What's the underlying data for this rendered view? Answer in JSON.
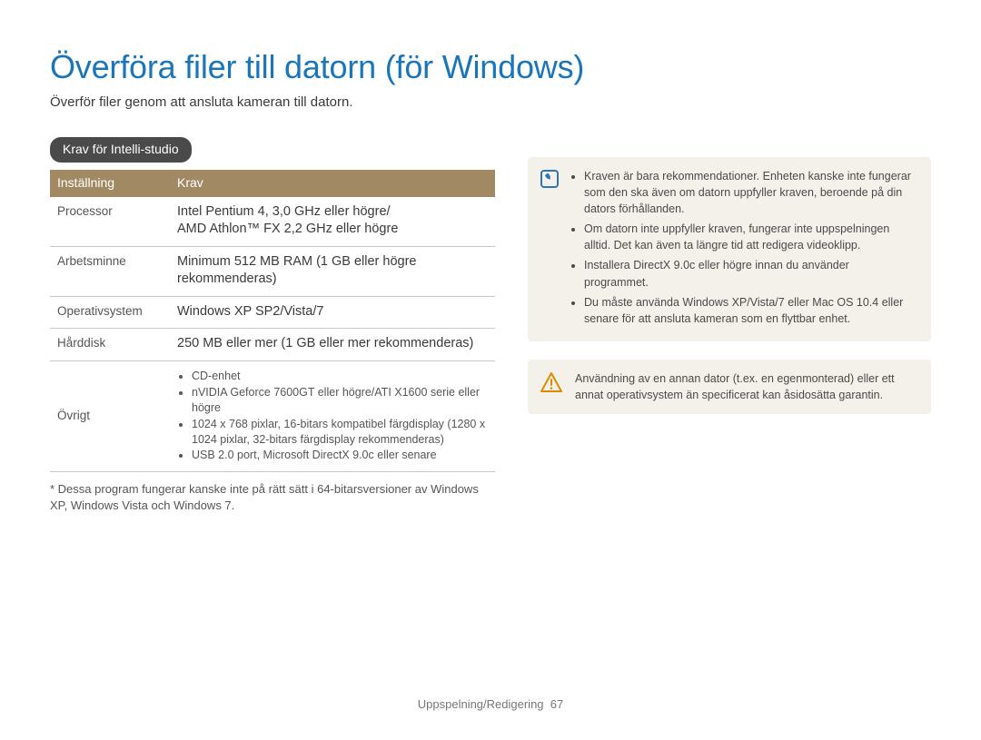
{
  "page": {
    "title": "Överföra filer till datorn (för Windows)",
    "intro": "Överför filer genom att ansluta kameran till datorn."
  },
  "section": {
    "pill": "Krav för Intelli-studio"
  },
  "table": {
    "head_setting": "Inställning",
    "head_req": "Krav",
    "rows": {
      "processor": {
        "label": "Processor",
        "value_line1": "Intel Pentium 4, 3,0 GHz eller högre/",
        "value_line2": "AMD Athlon™ FX 2,2 GHz eller högre"
      },
      "ram": {
        "label": "Arbetsminne",
        "value": "Minimum 512 MB RAM (1 GB eller högre rekommenderas)"
      },
      "os": {
        "label": "Operativsystem",
        "value": "Windows XP SP2/Vista/7"
      },
      "hdd": {
        "label": "Hårddisk",
        "value": "250 MB eller mer (1 GB eller mer rekommenderas)"
      },
      "other": {
        "label": "Övrigt",
        "items": {
          "0": "CD-enhet",
          "1": "nVIDIA Geforce 7600GT eller högre/ATI X1600 serie eller högre",
          "2": "1024 x 768 pixlar, 16-bitars kompatibel färgdisplay (1280 x 1024 pixlar, 32-bitars färgdisplay rekommenderas)",
          "3": "USB 2.0 port, Microsoft DirectX 9.0c eller senare"
        }
      }
    }
  },
  "footnote": "* Dessa program fungerar kanske inte på rätt sätt i 64-bitarsversioner av Windows XP, Windows Vista och Windows 7.",
  "notes": {
    "info_items": {
      "0": "Kraven är bara rekommendationer. Enheten kanske inte fungerar som den ska även om datorn uppfyller kraven, beroende på din dators förhållanden.",
      "1": "Om datorn inte uppfyller kraven, fungerar inte uppspelningen alltid. Det kan även ta längre tid att redigera videoklipp.",
      "2": "Installera DirectX 9.0c eller högre innan du använder programmet.",
      "3": "Du måste använda Windows XP/Vista/7 eller Mac OS 10.4 eller senare för att ansluta kameran som en flyttbar enhet."
    },
    "warning": "Användning av en annan dator (t.ex. en egenmonterad) eller ett annat operativsystem än specificerat kan åsidosätta garantin."
  },
  "footer": {
    "section": "Uppspelning/Redigering",
    "page_no": "67"
  }
}
